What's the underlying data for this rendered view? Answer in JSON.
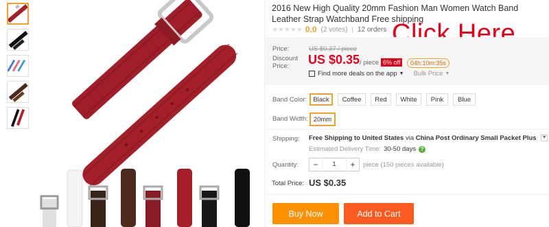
{
  "product": {
    "title": "2016 New High Quality 20mm Fashion Man Women Watch Band Leather Strap Watchband Free shipping",
    "rating": "0.0",
    "votes": "(2 votes)",
    "orders": "12 orders"
  },
  "promo": {
    "text": "Click Here",
    "color": "#e0001b"
  },
  "price": {
    "price_label": "Price:",
    "old_price": "US $0.37 / piece",
    "discount_label": "Discount Price:",
    "current_price": "US $0.35",
    "per_piece": "/ piece",
    "off_badge": "6% off",
    "timer": "04h:10m:35s",
    "app_deals": "Find more deals on the app",
    "bulk_price": "Bulk Price"
  },
  "options": {
    "band_color_label": "Band Color:",
    "colors": [
      "Black",
      "Coffee",
      "Red",
      "White",
      "Pink",
      "Blue"
    ],
    "selected_color": "Black",
    "band_width_label": "Band Width:",
    "width": "20mm"
  },
  "shipping": {
    "label": "Shipping:",
    "free": "Free Shipping to",
    "destination": "United States",
    "via": "via",
    "method": "China Post Ordinary Small Packet Plus",
    "est_label": "Estimated Delivery Time:",
    "days": "30-50 days"
  },
  "quantity": {
    "label": "Quantity:",
    "value": "1",
    "available": "piece (150 pieces available)"
  },
  "total": {
    "label": "Total Price:",
    "value": "US $0.35"
  },
  "actions": {
    "buy_now": "Buy Now",
    "add_to_cart": "Add to Cart"
  },
  "colors": {
    "accent_orange": "#ff9000",
    "cart_orange": "#ff5a1f",
    "price_red": "#e0001b",
    "strap_red": "#a3202b"
  }
}
